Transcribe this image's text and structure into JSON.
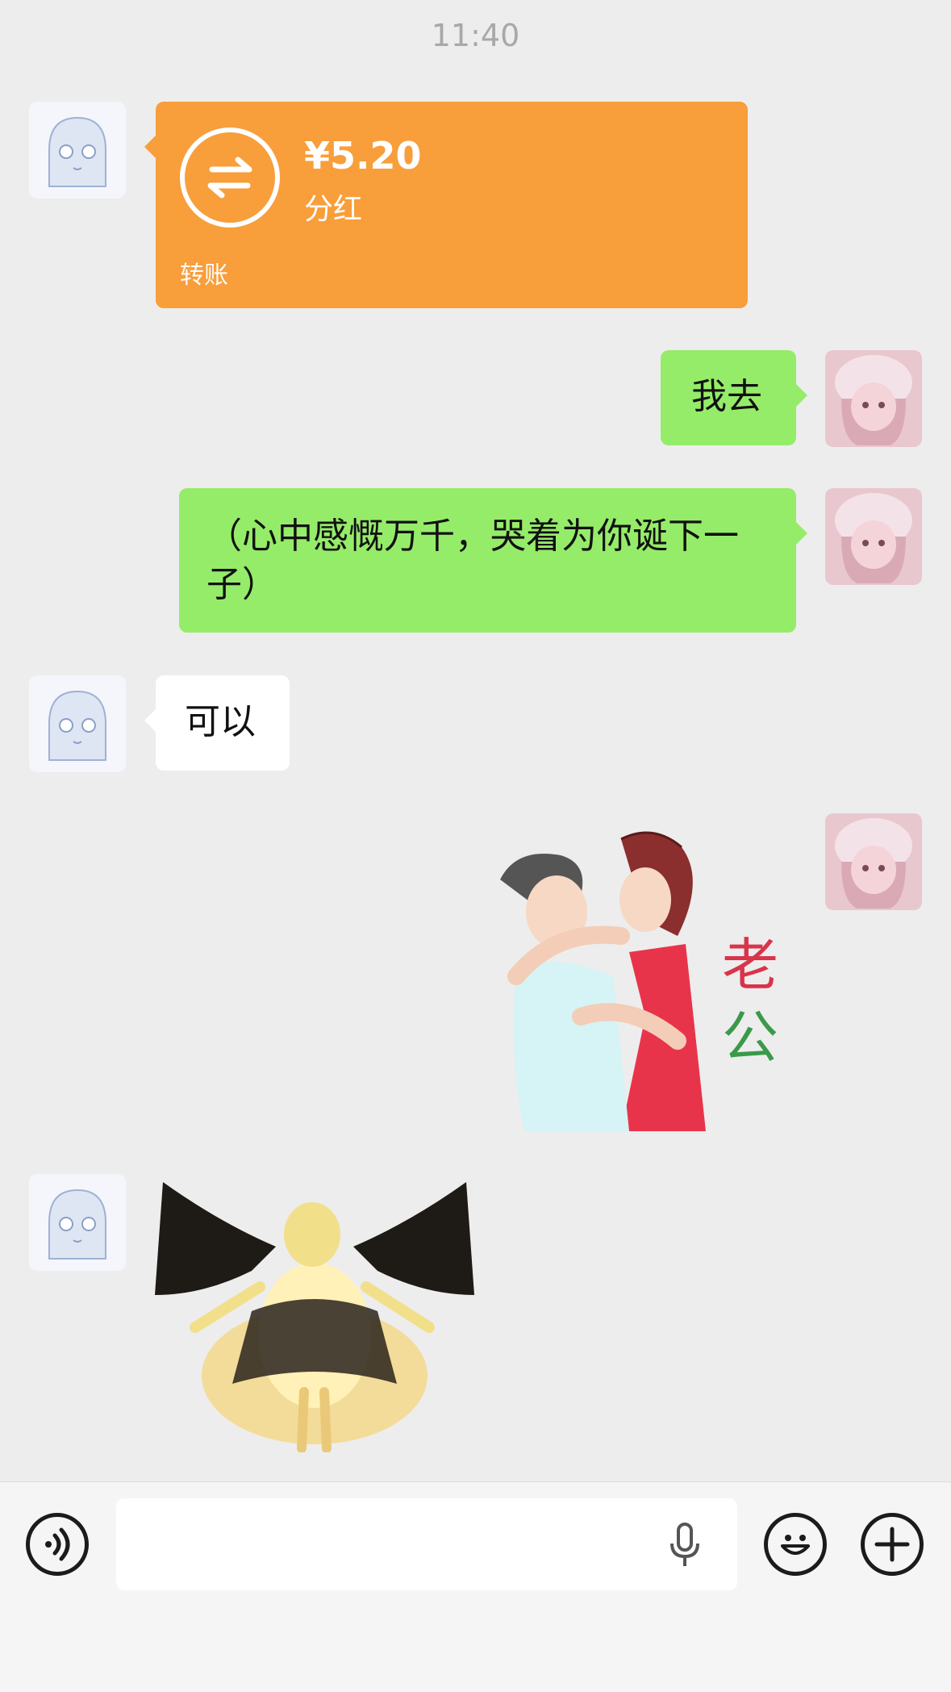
{
  "timestamp": "11:40",
  "messages": {
    "transfer": {
      "amount": "¥5.20",
      "note": "分红",
      "type_label": "转账"
    },
    "sent_text_1": "我去",
    "sent_text_2": "（心中感慨万千，哭着为你诞下一子）",
    "received_text_1": "可以",
    "sticker_couple": {
      "caption_line1": "老",
      "caption_line2": "公"
    },
    "sticker_angel": {}
  },
  "colors": {
    "background": "#ededed",
    "green_bubble": "#95ec69",
    "transfer_orange": "#f89e3b",
    "white_bubble": "#ffffff"
  },
  "input_bar": {
    "voice_icon": "voice-icon",
    "mic_icon": "microphone-icon",
    "emoji_icon": "emoji-icon",
    "plus_icon": "plus-icon"
  }
}
